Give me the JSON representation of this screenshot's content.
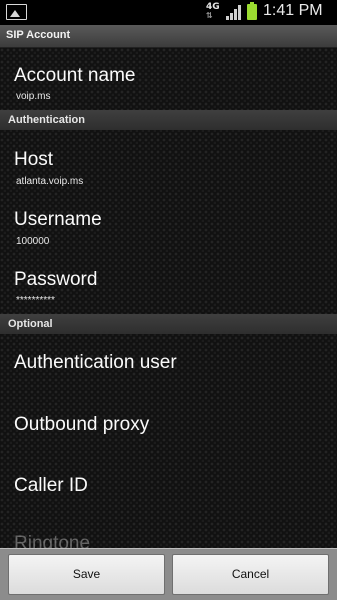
{
  "status_bar": {
    "network_type": "4G",
    "time": "1:41 PM",
    "icons": [
      "picture-icon",
      "data-arrows-icon",
      "signal-icon",
      "battery-icon"
    ],
    "battery_color": "#9bdc30"
  },
  "title_bar": {
    "title": "SIP Account"
  },
  "preferences": {
    "account_name": {
      "title": "Account name",
      "summary": "voip.ms"
    },
    "authentication_header": "Authentication",
    "host": {
      "title": "Host",
      "summary": "atlanta.voip.ms"
    },
    "username": {
      "title": "Username",
      "summary": "100000"
    },
    "password": {
      "title": "Password",
      "summary": "**********"
    },
    "optional_header": "Optional",
    "authentication_user": {
      "title": "Authentication user"
    },
    "outbound_proxy": {
      "title": "Outbound proxy"
    },
    "caller_id": {
      "title": "Caller ID"
    },
    "ringtone": {
      "title": "Ringtone"
    }
  },
  "buttons": {
    "save": "Save",
    "cancel": "Cancel"
  }
}
